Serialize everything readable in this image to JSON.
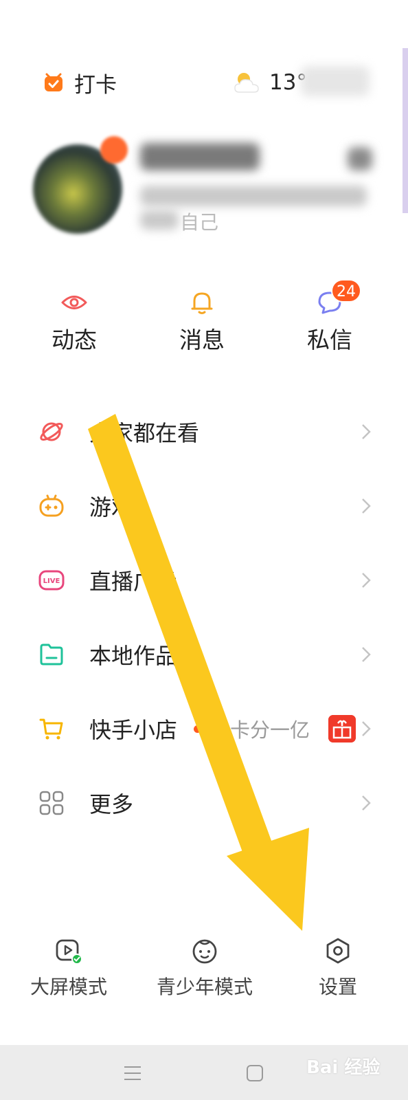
{
  "header": {
    "checkin_label": "打卡",
    "weather_temp": "13°"
  },
  "profile": {
    "bio_tail": "自己"
  },
  "quick_actions": [
    {
      "label": "动态",
      "icon": "eye-icon",
      "color": "#f25a5a"
    },
    {
      "label": "消息",
      "icon": "bell-icon",
      "color": "#f5a623"
    },
    {
      "label": "私信",
      "icon": "chat-bubble-icon",
      "color": "#7a7ff0",
      "badge": "24"
    }
  ],
  "menu": [
    {
      "label": "大家都在看",
      "icon": "planet-icon",
      "color": "#f25a5a"
    },
    {
      "label": "游戏",
      "icon": "gamepad-icon",
      "color": "#f5a020"
    },
    {
      "label": "直播广场",
      "icon": "live-icon",
      "color": "#e8467c"
    },
    {
      "label": "本地作品集",
      "icon": "folder-icon",
      "color": "#1fc29a"
    },
    {
      "label": "快手小店",
      "icon": "cart-icon",
      "color": "#f7b500",
      "promo": "集卡分一亿"
    },
    {
      "label": "更多",
      "icon": "grid-icon",
      "color": "#888888"
    }
  ],
  "bottom_actions": [
    {
      "label": "大屏模式",
      "icon": "big-screen-icon"
    },
    {
      "label": "青少年模式",
      "icon": "child-face-icon"
    },
    {
      "label": "设置",
      "icon": "settings-icon"
    }
  ],
  "watermark": "Bai 经验",
  "colors": {
    "accent": "#ff5a1f",
    "arrow": "#fbc81e"
  }
}
